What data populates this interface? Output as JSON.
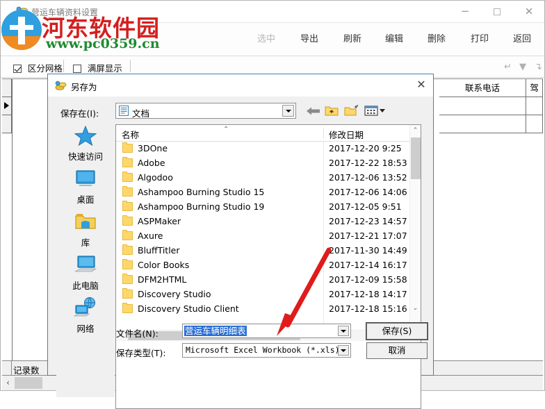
{
  "app": {
    "title": "营运车辆资料设置",
    "title_icon": "money-icon",
    "window_controls": {
      "minimize": "─",
      "maximize": "□",
      "close": "✕"
    },
    "toolbar": [
      {
        "label": "选中",
        "disabled": true
      },
      {
        "label": "导出",
        "disabled": false
      },
      {
        "label": "刷新",
        "disabled": false
      },
      {
        "label": "编辑",
        "disabled": false
      },
      {
        "label": "删除",
        "disabled": false
      },
      {
        "label": "打印",
        "disabled": false
      },
      {
        "label": "返回",
        "disabled": false
      }
    ],
    "options": [
      {
        "label": "区分网格",
        "checked": true
      },
      {
        "label": "满屏显示",
        "checked": false
      }
    ],
    "nav_arrows": [
      "↵",
      "▼",
      "↴"
    ],
    "grid_columns": [
      "联系电话",
      "驾"
    ],
    "status": {
      "record_count_label": "记录数"
    },
    "hscroll": {
      "left_arrow": "‹"
    }
  },
  "watermark": {
    "site_name": "河东软件园",
    "url": "www.pc0359.cn",
    "name_color": "#d41f1f",
    "url_color": "#1f8a2f",
    "logo_blue": "#2f9fe0",
    "logo_orange": "#f08a22"
  },
  "dialog": {
    "title": "另存为",
    "title_icon": "money-icon",
    "close_glyph": "✕",
    "lookin": {
      "label": "保存在(I):",
      "value": "文档",
      "icon": "documents-folder-icon"
    },
    "nav": {
      "back": "back-arrow-icon",
      "up": "up-folder-icon",
      "new_folder": "new-folder-icon",
      "views": "views-dropdown-icon"
    },
    "places": [
      {
        "label": "快速访问",
        "icon": "star-icon"
      },
      {
        "label": "桌面",
        "icon": "desktop-icon"
      },
      {
        "label": "库",
        "icon": "library-folder-icon"
      },
      {
        "label": "此电脑",
        "icon": "this-pc-icon"
      },
      {
        "label": "网络",
        "icon": "network-icon"
      }
    ],
    "filelist": {
      "columns": [
        "名称",
        "修改日期"
      ],
      "sort_mark": "⌃",
      "rows": [
        {
          "name": "3DOne",
          "date": "2017-12-20 9:25"
        },
        {
          "name": "Adobe",
          "date": "2017-12-22 18:53"
        },
        {
          "name": "Algodoo",
          "date": "2017-12-06 13:52"
        },
        {
          "name": "Ashampoo Burning Studio 15",
          "date": "2017-12-06 14:06"
        },
        {
          "name": "Ashampoo Burning Studio 19",
          "date": "2017-12-05 9:51"
        },
        {
          "name": "ASPMaker",
          "date": "2017-12-23 14:57"
        },
        {
          "name": "Axure",
          "date": "2017-12-21 17:07"
        },
        {
          "name": "BluffTitler",
          "date": "2017-11-30 14:49"
        },
        {
          "name": "Color Books",
          "date": "2017-12-14 16:17"
        },
        {
          "name": "DFM2HTML",
          "date": "2017-12-09 15:58"
        },
        {
          "name": "Discovery Studio",
          "date": "2017-12-18 14:17"
        },
        {
          "name": "Discovery Studio Client",
          "date": "2017-12-18 15:16"
        }
      ],
      "scroll": {
        "up": "⌃",
        "down": "⌄",
        "left": "‹",
        "right": "›"
      }
    },
    "filename": {
      "label": "文件名(N):",
      "value": "营运车辆明细表",
      "selected": true,
      "selection_color": "#2b6fd6"
    },
    "filetype": {
      "label": "保存类型(T):",
      "value": "Microsoft Excel Workbook (*.xls)"
    },
    "buttons": {
      "save": "保存(S)",
      "cancel": "取消"
    }
  },
  "annotation": {
    "arrow_color": "#e01b1b",
    "description": "red-arrow-pointing-to-filename-field"
  }
}
